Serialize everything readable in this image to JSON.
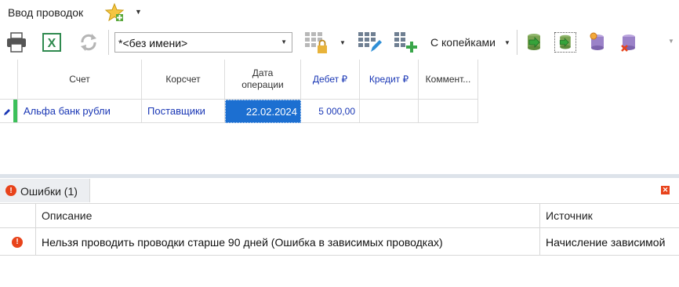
{
  "title": "Ввод проводок",
  "toolbar": {
    "combo_value": "*<без имени>",
    "kopeyki_label": "С копейками"
  },
  "grid": {
    "columns": [
      "Счет",
      "Корсчет",
      "Дата операции",
      "Дебет ₽",
      "Кредит ₽",
      "Коммент..."
    ],
    "rows": [
      {
        "schet": "Альфа банк рубли",
        "korschet": "Поставщики",
        "date": "22.02.2024",
        "debet": "5 000,00",
        "kredit": "",
        "comment": ""
      }
    ]
  },
  "errors": {
    "tab_label": "Ошибки (1)",
    "columns": {
      "description": "Описание",
      "source": "Источник"
    },
    "rows": [
      {
        "description": "Нельзя проводить проводки старше 90 дней (Ошибка в зависимых проводках)",
        "source": "Начисление зависимой"
      }
    ]
  },
  "colors": {
    "accent": "#1a37b5",
    "selection": "#1c6fd1",
    "error": "#e8431b"
  }
}
